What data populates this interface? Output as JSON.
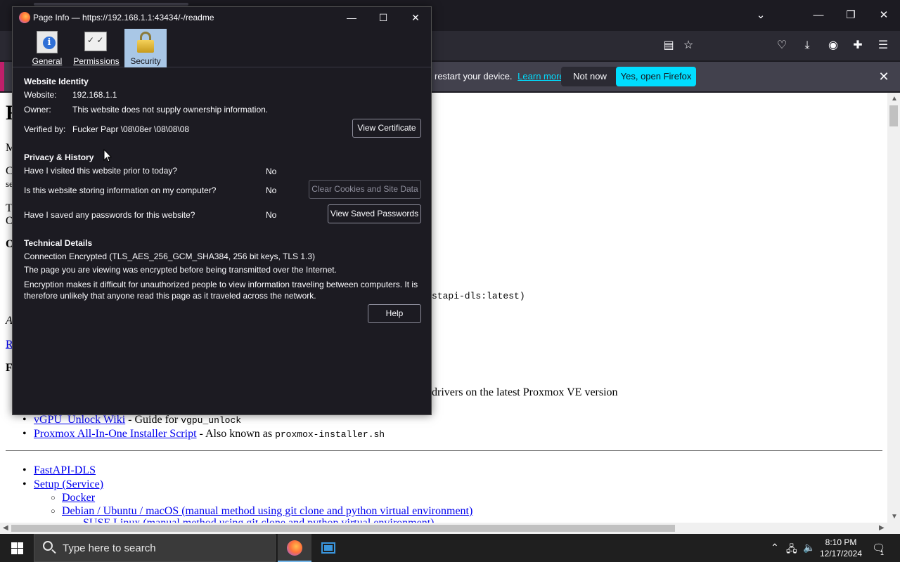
{
  "browser": {
    "notification": {
      "message": "restart your device.",
      "learn_more": "Learn more",
      "not_now": "Not now",
      "open_firefox": "Yes, open Firefox"
    }
  },
  "page": {
    "fragments": {
      "heading_initial": "F",
      "m": "M",
      "c": "C",
      "se": "se",
      "t": "T",
      "o": "O",
      "o_bold": "O",
      "a": "A",
      "r": "R",
      "f_bold": "F",
      "comma": ",",
      "image_tag": "stapi-dls:latest)",
      "drivers_text": "drivers on the latest Proxmox VE version"
    },
    "list1": [
      {
        "link": "vGPU_Unlock Wiki",
        "text": " - Guide for ",
        "code": "vgpu_unlock"
      },
      {
        "link": "Proxmox All-In-One Installer Script",
        "text": " - Also known as ",
        "code": "proxmox-installer.sh"
      }
    ],
    "list2": [
      {
        "link": "FastAPI-DLS"
      },
      {
        "link": "Setup (Service)"
      }
    ],
    "list2_sub": [
      {
        "link": "Docker"
      },
      {
        "link": "Debian / Ubuntu / macOS (manual method using git clone and python virtual environment)"
      }
    ],
    "cut_line": "SUSE Linux (manual method using git clone and python virtual environment)"
  },
  "dialog": {
    "title": "Page Info — https://192.168.1.1:43434/-/readme",
    "tabs": [
      {
        "label": "General",
        "icon": "info-icon"
      },
      {
        "label": "Permissions",
        "icon": "permissions-icon"
      },
      {
        "label": "Security",
        "icon": "lock-icon",
        "selected": true
      }
    ],
    "identity": {
      "heading": "Website Identity",
      "website_label": "Website:",
      "website_value": "192.168.1.1",
      "owner_label": "Owner:",
      "owner_value": "This website does not supply ownership information.",
      "verified_label": "Verified by:",
      "verified_value": "Fucker Papr \\08\\08er \\08\\08\\08",
      "view_certificate": "View Certificate"
    },
    "privacy": {
      "heading": "Privacy & History",
      "q1": "Have I visited this website prior to today?",
      "a1": "No",
      "q2": "Is this website storing information on my computer?",
      "a2": "No",
      "clear_button": "Clear Cookies and Site Data",
      "q3": "Have I saved any passwords for this website?",
      "a3": "No",
      "passwords_button": "View Saved Passwords"
    },
    "technical": {
      "heading": "Technical Details",
      "line1": "Connection Encrypted (TLS_AES_256_GCM_SHA384, 256 bit keys, TLS 1.3)",
      "line2": "The page you are viewing was encrypted before being transmitted over the Internet.",
      "line3": "Encryption makes it difficult for unauthorized people to view information traveling between computers. It is therefore unlikely that anyone read this page as it traveled across the network.",
      "help": "Help"
    }
  },
  "taskbar": {
    "search_placeholder": "Type here to search",
    "time": "8:10 PM",
    "date": "12/17/2024",
    "notification_count": "1"
  }
}
